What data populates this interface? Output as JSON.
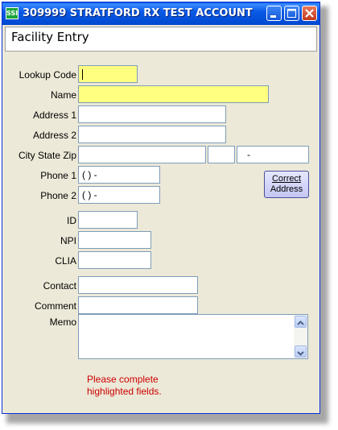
{
  "window": {
    "title": "309999 STRATFORD RX TEST ACCOUNT",
    "app_icon_text": "SSI"
  },
  "header": {
    "title": "Facility Entry"
  },
  "form": {
    "labels": {
      "lookup_code": "Lookup Code",
      "name": "Name",
      "address1": "Address 1",
      "address2": "Address 2",
      "city_state_zip": "City State Zip",
      "phone1": "Phone 1",
      "phone2": "Phone 2",
      "id": "ID",
      "npi": "NPI",
      "clia": "CLIA",
      "contact": "Contact",
      "comment": "Comment",
      "memo": "Memo"
    },
    "values": {
      "lookup_code": "",
      "name": "",
      "address1": "",
      "address2": "",
      "city": "",
      "state": "",
      "zip": "  -",
      "phone1": "(  )   -",
      "phone2": "(  )   -",
      "id": "",
      "npi": "",
      "clia": "",
      "contact": "",
      "comment": "",
      "memo": ""
    },
    "required_highlight_color": "#ffff80"
  },
  "buttons": {
    "correct_address_line1": "Correct",
    "correct_address_line2": "Address"
  },
  "message": "Please complete\nhighlighted fields."
}
